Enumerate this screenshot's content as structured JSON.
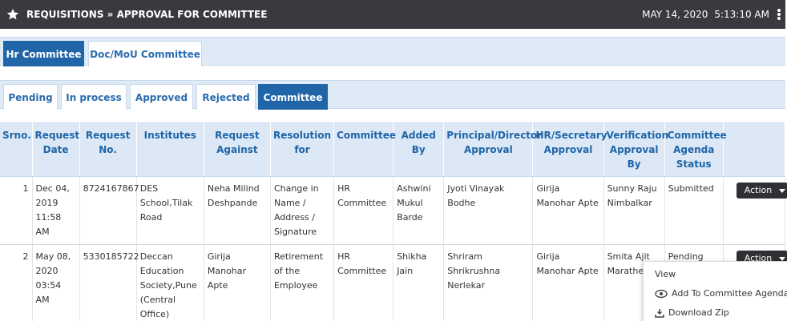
{
  "header": {
    "title": "REQUISITIONS » APPROVAL FOR COMMITTEE",
    "date": "MAY 14, 2020",
    "time": "5:13:10 AM"
  },
  "committee_tabs": [
    {
      "label": "Hr Committee",
      "active": true
    },
    {
      "label": "Doc/MoU Committee",
      "active": false
    }
  ],
  "status_tabs": [
    {
      "label": "Pending",
      "active": false
    },
    {
      "label": "In process",
      "active": false
    },
    {
      "label": "Approved",
      "active": false
    },
    {
      "label": "Rejected",
      "active": false
    },
    {
      "label": "Committee",
      "active": true
    }
  ],
  "table": {
    "columns": [
      "Srno.",
      "Request Date",
      "Request No.",
      "Institutes",
      "Request Against",
      "Resolution for",
      "Committee",
      "Added By",
      "Principal/Director Approval",
      "HR/Secretary Approval",
      "Verification Approval By",
      "Committee Agenda Status",
      ""
    ],
    "rows": [
      {
        "srno": "1",
        "request_date": "Dec 04, 2019 11:58 AM",
        "request_no": "8724167867",
        "institute": "DES School,Tilak Road",
        "request_against": "Neha Milind Deshpande",
        "resolution_for": "Change in Name / Address / Signature",
        "committee": "HR Committee",
        "added_by": "Ashwini Mukul Barde",
        "principal_approval": "Jyoti Vinayak Bodhe",
        "hr_approval": "Girija Manohar Apte",
        "verification_by": "Sunny Raju Nimbalkar",
        "agenda_status": "Submitted",
        "action_label": "Action"
      },
      {
        "srno": "2",
        "request_date": "May 08, 2020 03:54 AM",
        "request_no": "5330185722",
        "institute": "Deccan Education Society,Pune (Central Office)",
        "request_against": "Girija Manohar Apte",
        "resolution_for": "Retirement of the Employee",
        "committee": "HR Committee",
        "added_by": "Shikha Jain",
        "principal_approval": "Shriram Shrikrushna Nerlekar",
        "hr_approval": "Girija Manohar Apte",
        "verification_by": "Smita Ajit Marathe",
        "agenda_status": "Pending",
        "action_label": "Action"
      }
    ]
  },
  "action_menu": {
    "items": [
      {
        "label": "View",
        "icon": "none"
      },
      {
        "label": "Add To Committee Agenda",
        "icon": "eye-icon"
      },
      {
        "label": "Download Zip",
        "icon": "download-icon"
      }
    ]
  }
}
